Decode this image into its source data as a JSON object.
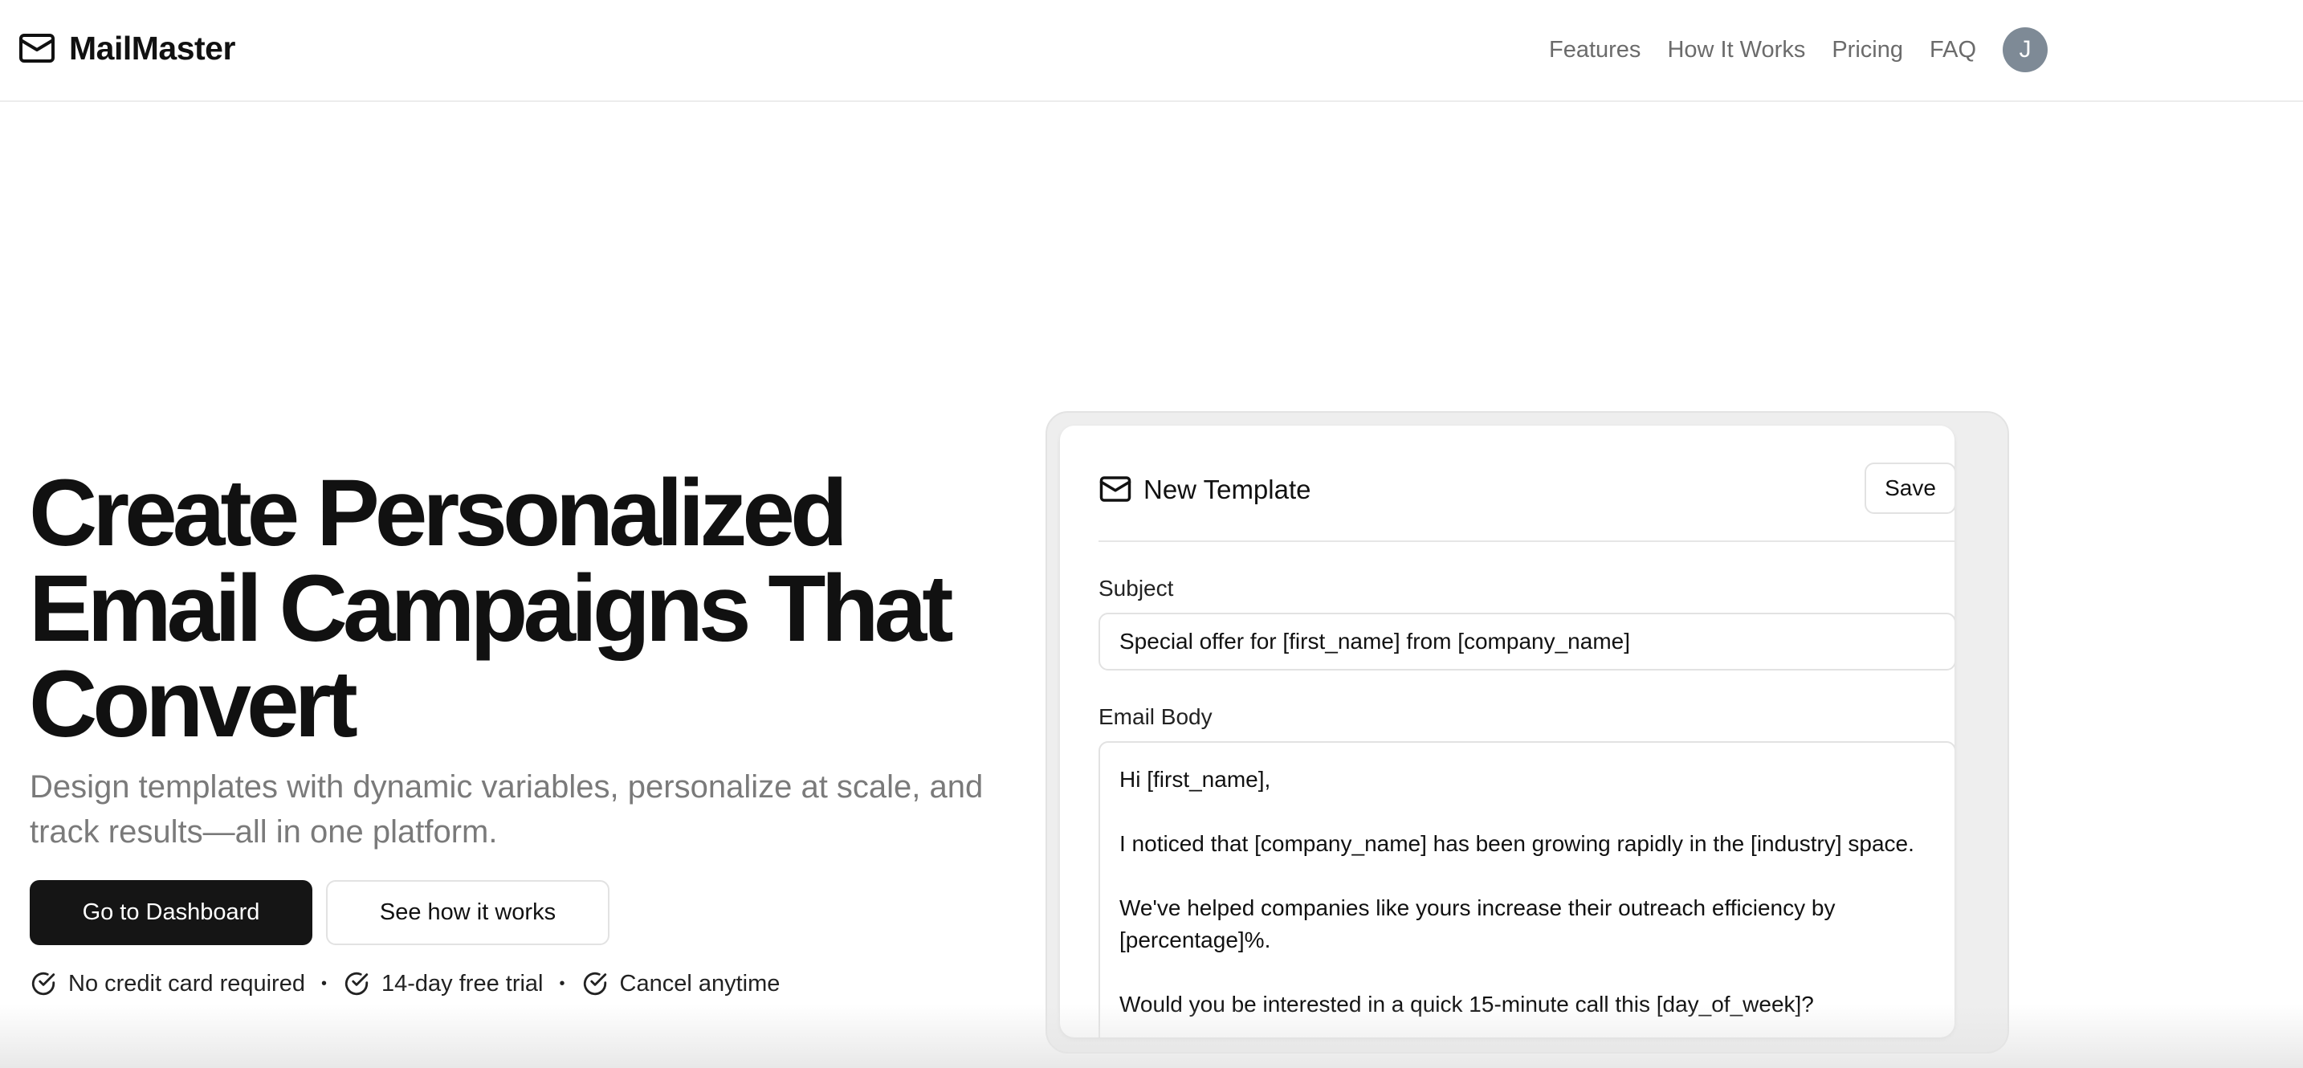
{
  "header": {
    "brand": "MailMaster",
    "brand_icon": "mail-icon",
    "nav": [
      "Features",
      "How It Works",
      "Pricing",
      "FAQ"
    ],
    "avatar_initial": "J",
    "avatar_color": "#7e8a96"
  },
  "hero": {
    "title": "Create Personalized Email Campaigns That Convert",
    "subtitle": "Design templates with dynamic variables, personalize at scale, and track results—all in one platform.",
    "primary_cta": "Go to Dashboard",
    "secondary_cta": "See how it works",
    "perks": [
      "No credit card required",
      "14-day free trial",
      "Cancel anytime"
    ],
    "perk_icon": "check-circle-icon"
  },
  "template_card": {
    "title": "New Template",
    "icon": "mail-icon",
    "save_label": "Save",
    "subject_label": "Subject",
    "subject_value": "Special offer for [first_name] from [company_name]",
    "body_label": "Email Body",
    "body_value": "Hi [first_name],\n\nI noticed that [company_name] has been growing rapidly in the [industry] space.\n\nWe've helped companies like yours increase their outreach efficiency by [percentage]%.\n\nWould you be interested in a quick 15-minute call this [day_of_week]?"
  },
  "colors": {
    "primary_button": "#151515",
    "muted_text": "#7a7a7a",
    "nav_text": "#6b6b6b"
  }
}
